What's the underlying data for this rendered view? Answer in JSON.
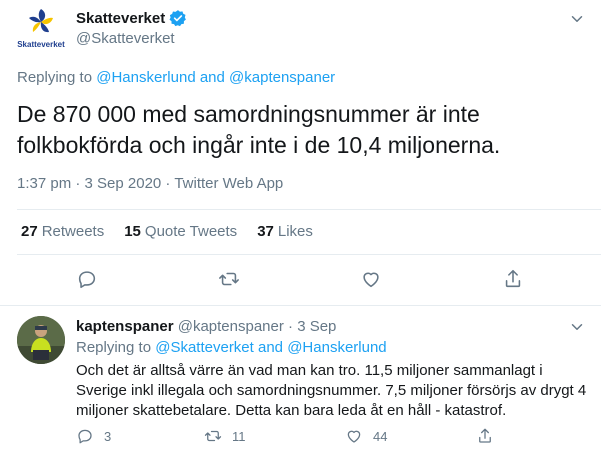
{
  "tweet": {
    "author_name": "Skatteverket",
    "author_handle": "@Skatteverket",
    "logo_text": "Skatteverket",
    "replying_prefix": "Replying to",
    "replying_user1": "@Hanskerlund",
    "replying_and": "and",
    "replying_user2": "@kaptenspaner",
    "text": "De 870 000 med samordningsnummer är inte folkbokförda och ingår inte i de 10,4 miljonerna.",
    "timestamp": "1:37 pm · 3 Sep 2020 · Twitter Web App",
    "stats": {
      "retweets_count": "27",
      "retweets_label": "Retweets",
      "quotes_count": "15",
      "quotes_label": "Quote Tweets",
      "likes_count": "37",
      "likes_label": "Likes"
    }
  },
  "reply": {
    "author_name": "kaptenspaner",
    "author_handle": "@kaptenspaner",
    "separator": "·",
    "date": "3 Sep",
    "replying_prefix": "Replying to",
    "replying_user1": "@Skatteverket",
    "replying_and": "and",
    "replying_user2": "@Hanskerlund",
    "text": "Och det är alltså värre än vad man kan tro. 11,5 miljoner sammanlagt i Sverige inkl illegala och samordningsnummer. 7,5 miljoner försörjs av drygt 4 miljoner skattebetalare. Detta kan bara leda åt en håll - katastrof.",
    "replies_count": "3",
    "retweets_count": "11",
    "likes_count": "44"
  },
  "colors": {
    "accent": "#1da1f2",
    "muted": "#657786",
    "text": "#14171a",
    "border": "#e6ecf0",
    "logo_blue": "#1f3f8f",
    "logo_yellow": "#f5c400"
  },
  "icons": [
    "verified-badge-icon",
    "chevron-down-icon",
    "reply-icon",
    "retweet-icon",
    "like-icon",
    "share-icon"
  ]
}
